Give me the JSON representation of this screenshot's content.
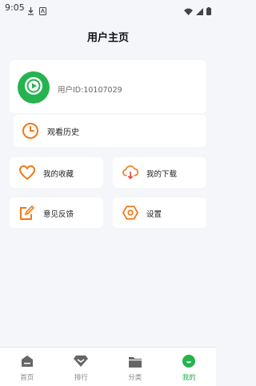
{
  "status_bar": {
    "time": "9:05"
  },
  "page": {
    "title": "用户主页"
  },
  "profile": {
    "user_id_text": "用户ID:10107029"
  },
  "history": {
    "label": "观看历史"
  },
  "tiles": [
    {
      "label": "我的收藏",
      "icon": "heart-icon"
    },
    {
      "label": "我的下载",
      "icon": "cloud-download-icon"
    },
    {
      "label": "意见反馈",
      "icon": "feedback-edit-icon"
    },
    {
      "label": "设置",
      "icon": "settings-hexagon-icon"
    }
  ],
  "tabbar": {
    "items": [
      {
        "label": "首页",
        "icon": "home-icon",
        "active": false
      },
      {
        "label": "排行",
        "icon": "rank-icon",
        "active": false
      },
      {
        "label": "分类",
        "icon": "folder-icon",
        "active": false
      },
      {
        "label": "我的",
        "icon": "profile-smile-icon",
        "active": true
      }
    ]
  },
  "colors": {
    "accent_green": "#25b34e",
    "orange": "#f07a1a",
    "background": "#f5f6fa"
  }
}
